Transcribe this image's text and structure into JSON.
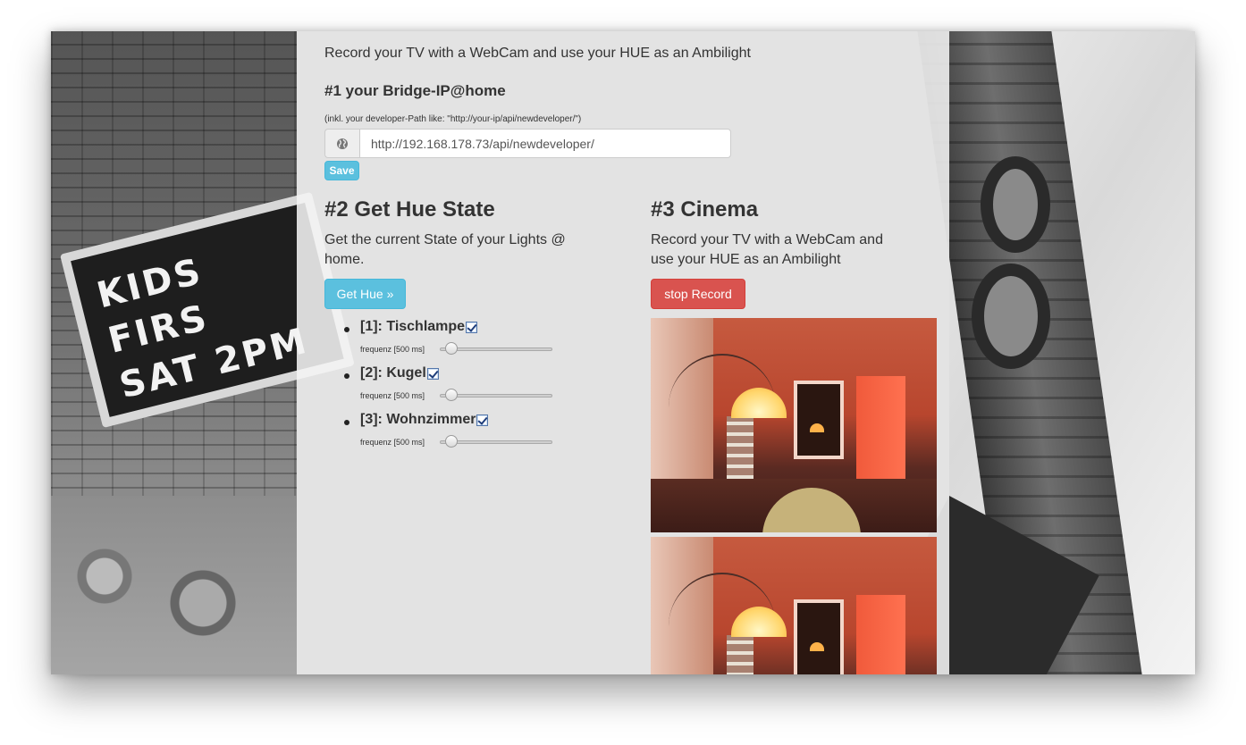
{
  "page": {
    "intro": "Record your TV with a WebCam and use your HUE as an Ambilight"
  },
  "bridge": {
    "heading": "#1 your Bridge-IP@home",
    "hint": "(inkl. your developer-Path like: \"http://your-ip/api/newdeveloper/\")",
    "url_value": "http://192.168.178.73/api/newdeveloper/",
    "save_label": "Save",
    "icon": "globe-icon"
  },
  "hue_state": {
    "heading": "#2 Get Hue State",
    "description": "Get the current State of your Lights @ home.",
    "button_label": "Get Hue »",
    "lights": [
      {
        "name": "[1]: Tischlampe",
        "enabled": true,
        "freq_label": "frequenz [500 ms]"
      },
      {
        "name": "[2]: Kugel",
        "enabled": true,
        "freq_label": "frequenz [500 ms]"
      },
      {
        "name": "[3]: Wohnzimmer",
        "enabled": true,
        "freq_label": "frequenz [500 ms]"
      }
    ]
  },
  "cinema": {
    "heading": "#3 Cinema",
    "description": "Record your TV with a WebCam and use your HUE as an Ambilight",
    "button_label": "stop Record"
  },
  "background": {
    "marquee_text_line1": "KIDS FIRS",
    "marquee_text_line2": "SAT   2PM"
  },
  "colors": {
    "info": "#5bc0de",
    "danger": "#d9534f",
    "panel": "#f4f4f4"
  }
}
